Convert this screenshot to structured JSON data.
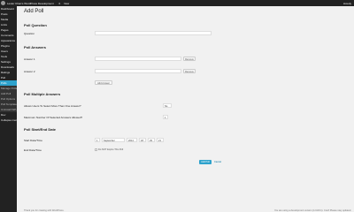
{
  "admin_bar": {
    "site_name": "Lester Chan's WordPress Development",
    "comments_count": "0",
    "new_label": "New",
    "howdy": "Howdy"
  },
  "sidebar": {
    "items": [
      {
        "label": "Dashboard",
        "state": "normal"
      },
      {
        "label": "Posts",
        "state": "normal"
      },
      {
        "label": "Media",
        "state": "normal"
      },
      {
        "label": "Links",
        "state": "normal"
      },
      {
        "label": "Pages",
        "state": "normal"
      },
      {
        "label": "Comments",
        "state": "normal"
      },
      {
        "label": "Appearance",
        "state": "normal"
      },
      {
        "label": "Plugins",
        "state": "normal"
      },
      {
        "label": "Users",
        "state": "normal"
      },
      {
        "label": "Tools",
        "state": "normal"
      },
      {
        "label": "Settings",
        "state": "normal"
      },
      {
        "label": "Downloads",
        "state": "normal"
      },
      {
        "label": "Ratings",
        "state": "normal"
      },
      {
        "label": "Poll",
        "state": "normal"
      },
      {
        "label": "Polls",
        "state": "active"
      },
      {
        "label": "Manage Polls",
        "state": "sub"
      },
      {
        "label": "Add Poll",
        "state": "sub"
      },
      {
        "label": "Poll Options",
        "state": "sub"
      },
      {
        "label": "Poll Templates",
        "state": "sub"
      },
      {
        "label": "Uninstall WP-Polls",
        "state": "sub"
      },
      {
        "label": "Dev",
        "state": "normal"
      },
      {
        "label": "Collapse menu",
        "state": "normal"
      }
    ]
  },
  "page": {
    "title": "Add Poll",
    "question_section": "Poll Question",
    "question_label": "Question",
    "answers_section": "Poll Answers",
    "answer1_label": "Answer 1",
    "answer2_label": "Answer 2",
    "remove_label": "Remove",
    "add_answer_label": "Add Answer",
    "multiple_section": "Poll Multiple Answers",
    "allow_multiple_label": "Allows Users To Select More Than One Answer?",
    "allow_multiple_value": "No",
    "max_answers_label": "Maximum Number Of Selected Answers Allowed?",
    "max_answers_value": "1",
    "dates_section": "Poll Start/End Date",
    "start_label": "Start Date/Time",
    "start_day": "1",
    "start_month": "September",
    "start_year": "2014",
    "start_hour": "18",
    "start_minute": "29",
    "start_second": "21",
    "end_label": "End Date/Time",
    "no_expiry_label": "Do NOT Expire This Poll",
    "add_poll_button": "Add Poll",
    "cancel_label": "Cancel"
  },
  "footer": {
    "left": "Thank you for creating with WordPress.",
    "right": "You are using a development version (4.0-RC1). Cool! Please stay updated."
  }
}
